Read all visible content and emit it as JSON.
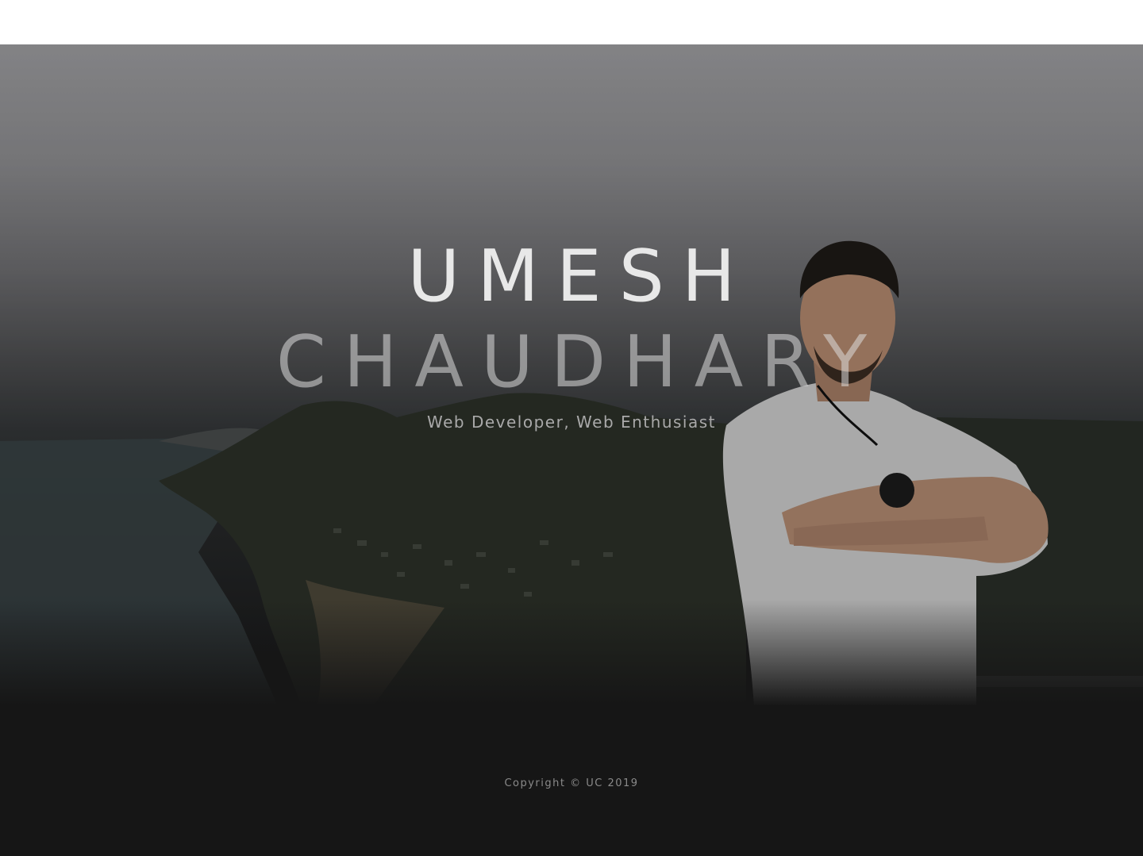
{
  "hero": {
    "first_name": "UMESH",
    "last_name": "CHAUDHARY",
    "tagline": "Web Developer, Web Enthusiast"
  },
  "footer": {
    "copyright": "Copyright © UC 2019"
  },
  "colors": {
    "header_bg": "#ffffff",
    "page_bg": "#161616",
    "title_text": "#e8e8e8",
    "tagline_text": "#a9a9a9",
    "footer_text": "#8a8a8a"
  }
}
